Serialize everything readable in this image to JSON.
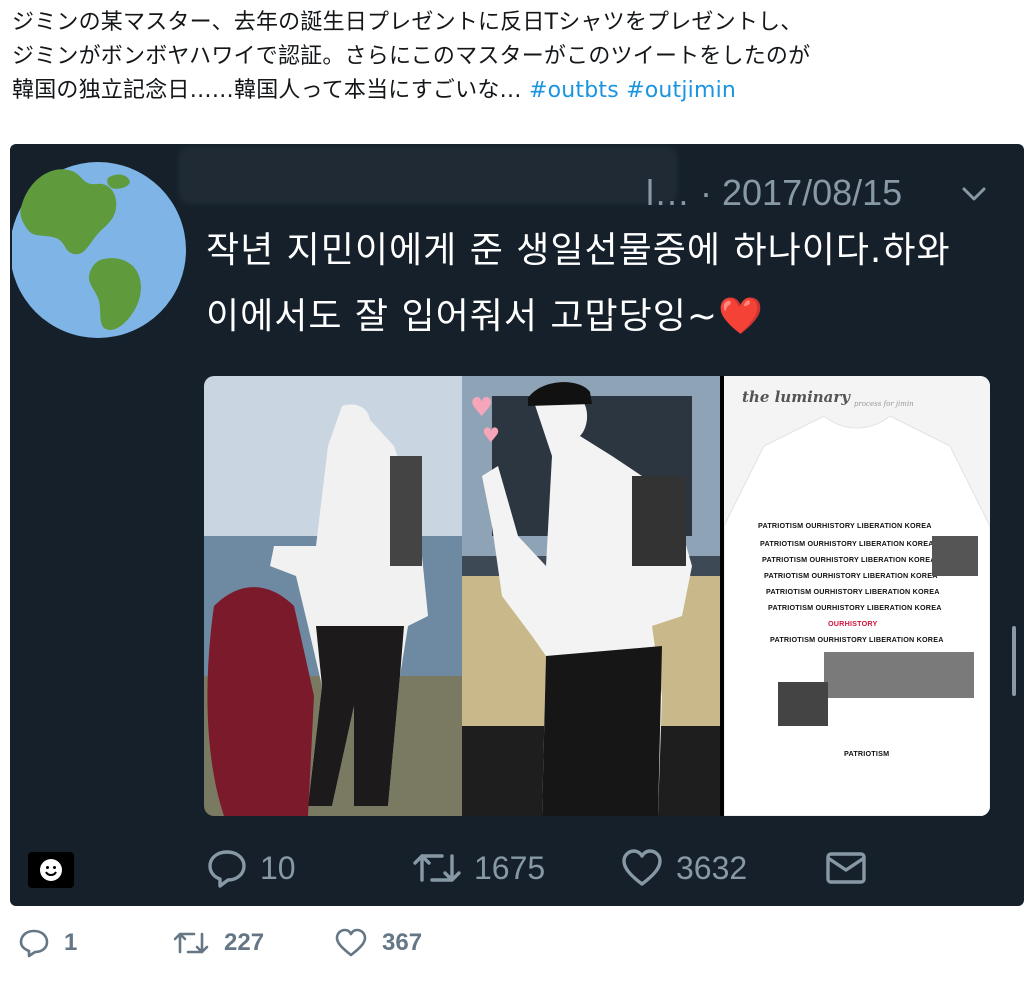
{
  "tweet": {
    "text_line1": "ジミンの某マスター、去年の誕生日プレゼントに反日Tシャツをプレゼントし、",
    "text_line2": "ジミンがボンボヤハワイで認証。さらにこのマスターがこのツイートをしたのが",
    "text_line3": "韓国の独立記念日……韓国人って本当にすごいな…",
    "hashtags": [
      "#outbts",
      "#outjimin"
    ]
  },
  "embedded": {
    "name_fragment": "l…",
    "date": "· 2017/08/15",
    "body_line1": "작년 지민이에게 준 생일선물중에 하나이다.하와",
    "body_line2": "이에서도 잘 입어줘서 고맙당잉~",
    "heart_glyph": "❤️",
    "media": {
      "brand": "the luminary",
      "brand_sub": "process for jimin",
      "shirt_text": "PATRIOTISM OURHISTORY LIBERATION KOREA",
      "shirt_highlight": "OURHISTORY",
      "shirt_bottom": "PATRIOTISM"
    },
    "actions": {
      "replies": "10",
      "retweets": "1675",
      "likes": "3632"
    }
  },
  "footer": {
    "replies": "1",
    "retweets": "227",
    "likes": "367"
  },
  "colors": {
    "hashtag": "#1b95e0",
    "embed_bg": "#15202b",
    "muted": "#8899a6",
    "heart": "#e0245e"
  },
  "icons": [
    "globe-icon",
    "chevron-down-icon",
    "reply-icon",
    "retweet-icon",
    "like-icon",
    "dm-icon",
    "emoji-icon"
  ]
}
